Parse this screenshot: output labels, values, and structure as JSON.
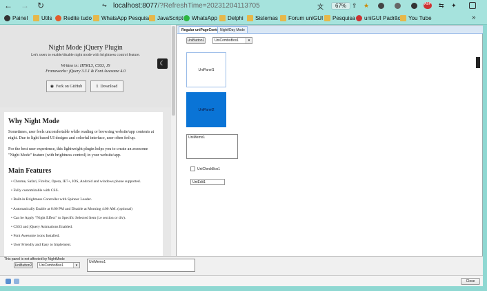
{
  "browser": {
    "url_host": "localhost:8077",
    "url_rest": "/?RefreshTime=20231204113705",
    "zoom": "67%",
    "bookmarks": [
      "Painel",
      "Utils",
      "Redite tudo",
      "WhatsApp Pesquisa",
      "JavaScript",
      "WhatsApp",
      "Delphi",
      "Sistemas",
      "Forum uniGUI",
      "Pesquisa",
      "uniGUI Padrão",
      "You Tube"
    ]
  },
  "hero": {
    "title": "Night Mode jQuery Plugin",
    "subtitle": "Let's users to enable/disable night mode with brightness control feature.",
    "written": "Written in: HTML5, CSS3, JS",
    "frameworks": "Frameworks: jQuery 3.3.1 & Font Awesome 4.0",
    "fork_label": "Fork on GitHub",
    "download_label": "Download"
  },
  "content": {
    "why_heading": "Why Night Mode",
    "why_p1": "Sometimes, user feels uncomfortable while reading or browsing website/app contents at night. Due to light based UI designs and colorful interface, user often fed up.",
    "why_p2": "For the best user experience, this lightweight plugin helps you to create an awesome \"Night Mode\" feature (with brightness control) in your website/app.",
    "features_heading": "Main Features",
    "features": [
      "Chrome, Safari, Firefox, Opera, IE7+, IOS, Android and windows phone supported.",
      "Fully customizable with CSS.",
      "Built-in Brightness Controller with Spinner Loader.",
      "Automatically Enable at 8:00 PM and Disable at Morning 4:00 AM. (optional)",
      "Can be Apply \"Night Effect\" to Specific Selected Item (i.e section or div).",
      "CSS3 and jQuery Animations Enabled.",
      "Font Awesome icons Installed.",
      "User Friendly and Easy to Implement."
    ]
  },
  "tabs": [
    "Regular uniPageControl",
    "Night/Day Mode"
  ],
  "controls": {
    "button1": "UniButton1",
    "combo1": "UniComboBox1",
    "panel1": "UniPanel1",
    "panel2": "UniPanel2",
    "memo1": "UniMemo1",
    "checkbox1": "UniCheckBox1",
    "edit1": "UniEdit1"
  },
  "bottom": {
    "note": "This panel is not affected by NightMode",
    "button": "UniButton2",
    "combo": "UniComboBox1",
    "memo": "UniMemo1"
  },
  "footer": {
    "close_label": "Close"
  },
  "colors": {
    "accent": "#0a74d6",
    "browser_bg": "#a6e3dd"
  }
}
